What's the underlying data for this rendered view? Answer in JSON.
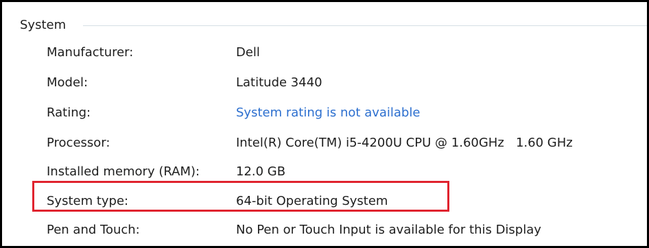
{
  "group": {
    "title": "System"
  },
  "rows": [
    {
      "label": "Manufacturer:",
      "value": "Dell"
    },
    {
      "label": "Model:",
      "value": "Latitude 3440"
    },
    {
      "label": "Rating:",
      "value": "System rating is not available"
    },
    {
      "label": "Processor:",
      "value": "Intel(R) Core(TM) i5-4200U CPU @ 1.60GHz   1.60 GHz"
    },
    {
      "label": "Installed memory (RAM):",
      "value": "12.0 GB"
    },
    {
      "label": "System type:",
      "value": "64-bit Operating System"
    },
    {
      "label": "Pen and Touch:",
      "value": "No Pen or Touch Input is available for this Display"
    }
  ],
  "colors": {
    "link": "#2c6fcf",
    "highlight_box": "#e0232e",
    "frame_border": "#000000"
  }
}
